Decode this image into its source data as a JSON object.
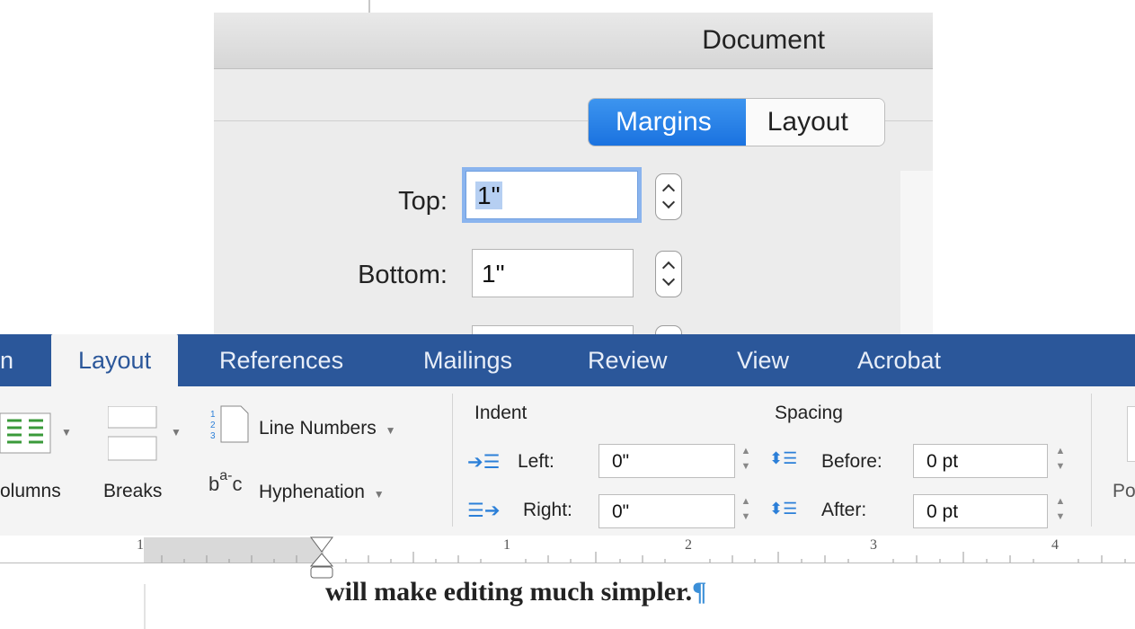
{
  "dialog": {
    "title": "Document",
    "segments": {
      "margins": "Margins",
      "layout": "Layout"
    },
    "fields": {
      "top": {
        "label": "Top:",
        "value": "1\""
      },
      "bottom": {
        "label": "Bottom:",
        "value": "1\""
      }
    }
  },
  "ribbon": {
    "tabs": [
      {
        "label": "n"
      },
      {
        "label": "Layout"
      },
      {
        "label": "References"
      },
      {
        "label": "Mailings"
      },
      {
        "label": "Review"
      },
      {
        "label": "View"
      },
      {
        "label": "Acrobat"
      }
    ],
    "columns_label": "olumns",
    "breaks_label": "Breaks",
    "line_numbers_label": "Line Numbers",
    "hyphenation_label": "Hyphenation",
    "indent": {
      "heading": "Indent",
      "left_label": "Left:",
      "left_value": "0\"",
      "right_label": "Right:",
      "right_value": "0\""
    },
    "spacing": {
      "heading": "Spacing",
      "before_label": "Before:",
      "before_value": "0 pt",
      "after_label": "After:",
      "after_value": "0 pt"
    },
    "position_partial": "Po"
  },
  "ruler": {
    "labels": [
      "1",
      "1",
      "2",
      "3",
      "4"
    ]
  },
  "document": {
    "text": "will make editing much simpler.",
    "pilcrow": "¶"
  }
}
